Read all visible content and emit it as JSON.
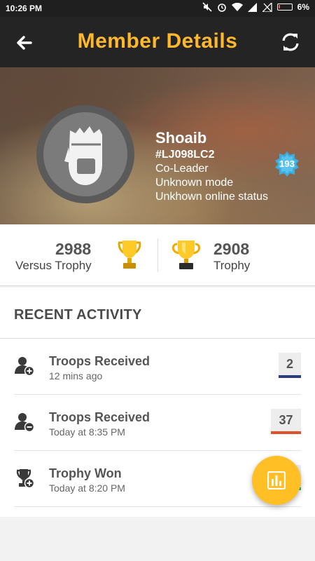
{
  "status_bar": {
    "time": "10:26 PM",
    "battery_percent": "6%",
    "battery_color": "#ff5252",
    "icons": [
      "mute-icon",
      "alarm-icon",
      "wifi-icon",
      "signal-icon",
      "no-sim-icon",
      "battery-icon"
    ]
  },
  "app_bar": {
    "title": "Member Details",
    "title_color": "#ffb82e",
    "back_icon": "arrow-left-icon",
    "refresh_icon": "sync-icon"
  },
  "profile": {
    "name": "Shoaib",
    "tag": "#LJ098LC2",
    "role": "Co-Leader",
    "mode": "Unknown mode",
    "online_status": "Unkhown online status",
    "level": "193",
    "level_badge_color": "#3aaee0"
  },
  "trophies": {
    "versus_value": "2988",
    "versus_label": "Versus Trophy",
    "trophy_value": "2908",
    "trophy_label": "Trophy",
    "versus_icon": "silver-trophy-icon",
    "trophy_icon": "gold-trophy-icon"
  },
  "recent_activity": {
    "heading": "RECENT ACTIVITY",
    "items": [
      {
        "title": "Troops Received",
        "time": "12 mins ago",
        "count": "2",
        "bar_color": "#2a3e84",
        "icon": "person-add-icon"
      },
      {
        "title": "Troops Received",
        "time": "Today at 8:35 PM",
        "count": "37",
        "bar_color": "#e0522a",
        "icon": "person-remove-icon"
      },
      {
        "title": "Trophy Won",
        "time": "Today at 8:20 PM",
        "count": "",
        "bar_color": "#1fbf6a",
        "icon": "trophy-add-icon"
      }
    ]
  },
  "fab": {
    "icon": "bar-chart-icon",
    "color": "#ffbf25"
  }
}
